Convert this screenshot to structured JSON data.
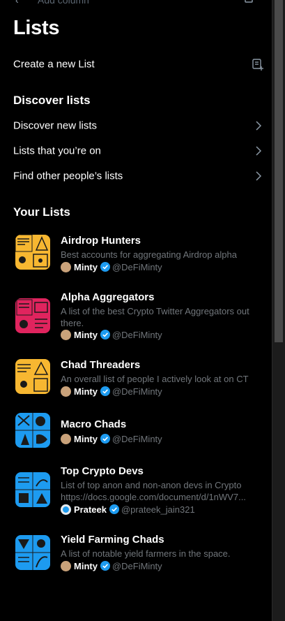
{
  "topbar": {
    "back_glyph": "‹",
    "add_column_label": "Add column",
    "icon": "trash-icon"
  },
  "page": {
    "title": "Lists"
  },
  "create": {
    "label": "Create a new List",
    "icon": "new-list-icon"
  },
  "discover": {
    "heading": "Discover lists",
    "items": [
      {
        "label": "Discover new lists"
      },
      {
        "label": "Lists that you’re on"
      },
      {
        "label": "Find other people’s lists"
      }
    ]
  },
  "your_lists": {
    "heading": "Your Lists",
    "items": [
      {
        "name": "Airdrop Hunters",
        "description": "Best accounts for aggregating Airdrop alpha",
        "owner_name": "Minty",
        "owner_handle": "@DeFiMinty",
        "color": "#f7b731"
      },
      {
        "name": "Alpha Aggregators",
        "description": "A list of the best Crypto Twitter Aggregators out there.",
        "owner_name": "Minty",
        "owner_handle": "@DeFiMinty",
        "color": "#e0245e"
      },
      {
        "name": "Chad Threaders",
        "description": "An overall list of people I actively look at on CT",
        "owner_name": "Minty",
        "owner_handle": "@DeFiMinty",
        "color": "#f7b731"
      },
      {
        "name": "Macro Chads",
        "description": "",
        "owner_name": "Minty",
        "owner_handle": "@DeFiMinty",
        "color": "#1d9bf0"
      },
      {
        "name": "Top Crypto Devs",
        "description": "List of top anon and non-anon devs in Crypto https://docs.google.com/document/d/1nWV7...",
        "owner_name": "Prateek",
        "owner_handle": "@prateek_jain321",
        "color": "#1d9bf0"
      },
      {
        "name": "Yield Farming Chads",
        "description": "A list of notable yield farmers in the space.",
        "owner_name": "Minty",
        "owner_handle": "@DeFiMinty",
        "color": "#1d9bf0"
      }
    ]
  },
  "colors": {
    "accent": "#1d9bf0",
    "text": "#e7e9ea",
    "muted": "#71767b",
    "background": "#000000"
  }
}
